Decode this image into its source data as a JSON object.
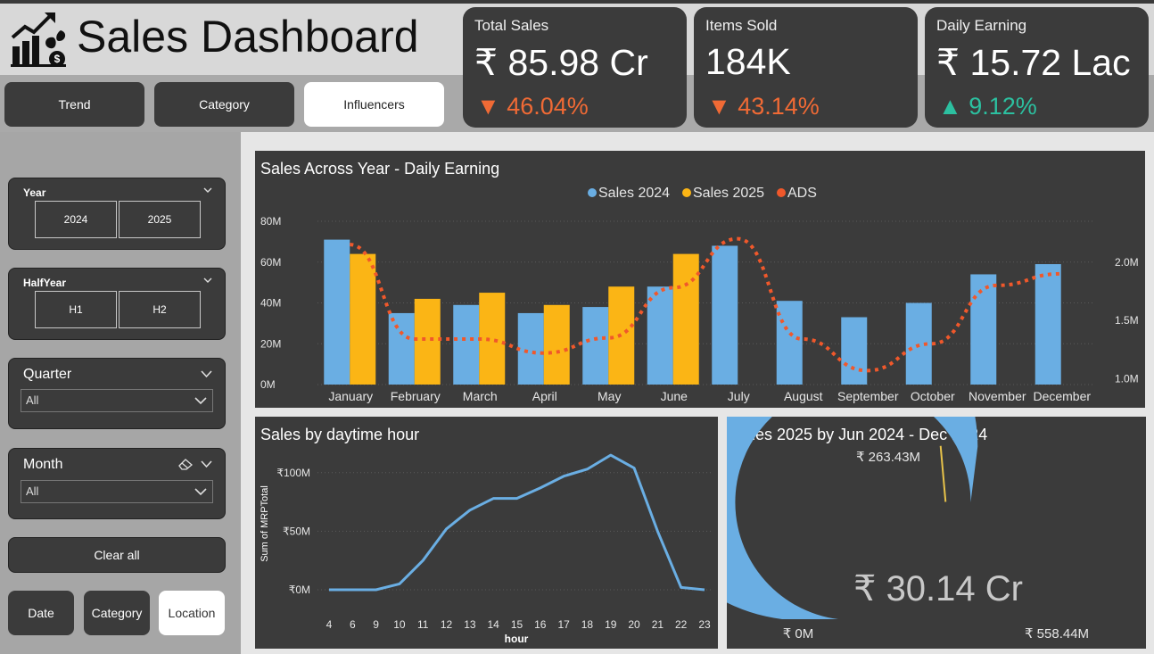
{
  "app": {
    "title": "Sales Dashboard"
  },
  "nav": [
    "Trend",
    "Category",
    "Influencers"
  ],
  "nav_active": 2,
  "kpis": [
    {
      "label": "Total Sales",
      "value": "₹ 85.98 Cr",
      "delta": "▼ 46.04%",
      "direction": "down"
    },
    {
      "label": "Items Sold",
      "value": "184K",
      "delta": "▼ 43.14%",
      "direction": "down"
    },
    {
      "label": "Daily Earning",
      "value": "₹ 15.72 Lac",
      "delta": "▲ 9.12%",
      "direction": "up"
    }
  ],
  "slicers": {
    "year": {
      "label": "Year",
      "options": [
        "2024",
        "2025"
      ]
    },
    "halfyear": {
      "label": "HalfYear",
      "options": [
        "H1",
        "H2"
      ]
    },
    "quarter": {
      "label": "Quarter",
      "value": "All"
    },
    "month": {
      "label": "Month",
      "value": "All"
    },
    "clear_all": "Clear all"
  },
  "subnav": [
    "Date",
    "Category",
    "Location"
  ],
  "subnav_active": 2,
  "colors": {
    "sales_2024": "#6aaee3",
    "sales_2025": "#fbb515",
    "ads": "#f0582b",
    "line": "#6aaee3",
    "panel": "#3b3b3b",
    "delta_down": "#f06a35",
    "delta_up": "#2cc0a0"
  },
  "icons": [
    "growth-chart-icon",
    "chevron-down-icon",
    "eraser-icon"
  ],
  "chart_data": [
    {
      "type": "bar",
      "title": "Sales Across Year - Daily Earning",
      "categories": [
        "January",
        "February",
        "March",
        "April",
        "May",
        "June",
        "July",
        "August",
        "September",
        "October",
        "November",
        "December"
      ],
      "series": [
        {
          "name": "Sales 2024",
          "values": [
            71,
            35,
            39,
            35,
            38,
            48,
            68,
            41,
            33,
            40,
            54,
            59
          ]
        },
        {
          "name": "Sales 2025",
          "values": [
            64,
            42,
            45,
            39,
            48,
            64,
            null,
            null,
            null,
            null,
            null,
            null
          ]
        },
        {
          "name": "ADS",
          "kind": "line",
          "axis": "secondary",
          "values": [
            2.15,
            1.34,
            1.34,
            1.22,
            1.35,
            1.78,
            2.2,
            1.34,
            1.07,
            1.3,
            1.8,
            1.9
          ]
        }
      ],
      "yticks": [
        "0M",
        "20M",
        "40M",
        "60M",
        "80M"
      ],
      "ylim": [
        0,
        80
      ],
      "y2ticks": [
        "1.0M",
        "1.5M",
        "2.0M"
      ],
      "y2lim": [
        0.95,
        2.35
      ],
      "legend": "top-center"
    },
    {
      "type": "line",
      "title": "Sales by daytime hour",
      "xlabel": "hour",
      "ylabel": "Sum of MRPTotal",
      "x": [
        4,
        6,
        9,
        10,
        11,
        12,
        13,
        14,
        15,
        16,
        17,
        18,
        19,
        20,
        21,
        22,
        23
      ],
      "values": [
        0,
        0,
        0,
        5,
        25,
        52,
        68,
        78,
        78,
        87,
        97,
        103,
        115,
        104,
        50,
        2,
        0
      ],
      "yticks": [
        "₹0M",
        "₹50M",
        "₹100M"
      ],
      "ylim": [
        0,
        125
      ]
    },
    {
      "type": "gauge",
      "title": "Sales 2025 by Jun 2024 - Dec 2024",
      "value": 301.4,
      "value_label": "₹ 30.14 Cr",
      "target": 263.43,
      "target_label": "₹ 263.43M",
      "min_label": "₹ 0M",
      "max_label": "₹ 558.44M",
      "min": 0,
      "max": 558.44
    }
  ]
}
